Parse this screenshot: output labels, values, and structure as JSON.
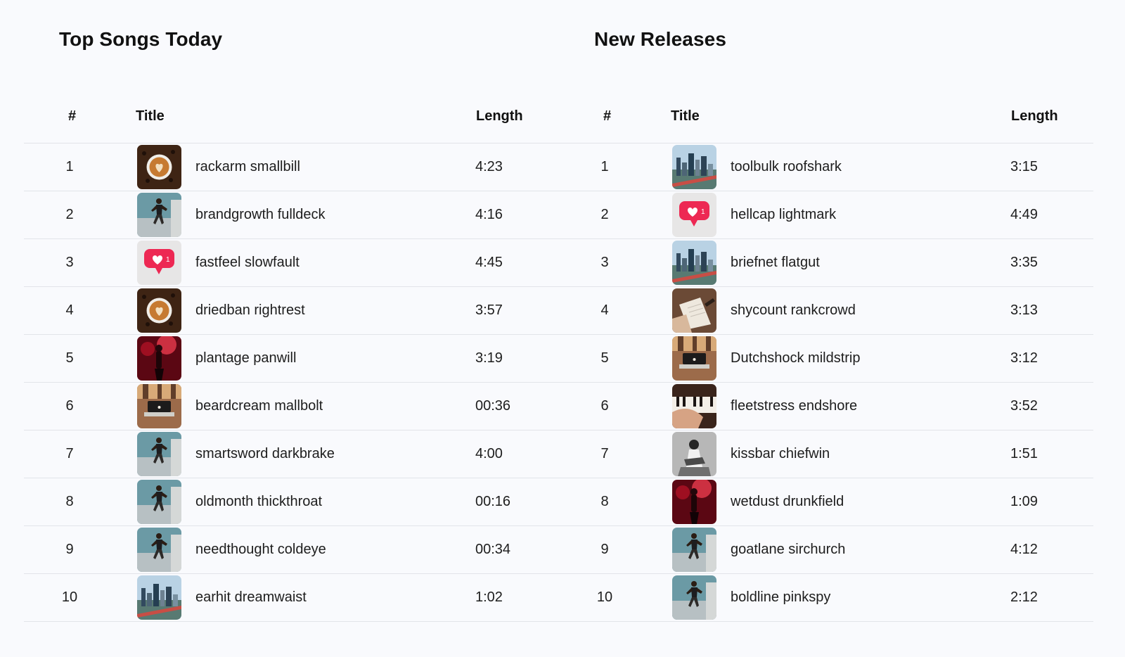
{
  "top_songs": {
    "title": "Top Songs Today",
    "columns": {
      "number": "#",
      "title": "Title",
      "length": "Length"
    },
    "rows": [
      {
        "number": "1",
        "title": "rackarm smallbill",
        "length": "4:23",
        "art": "coffee-latte-art"
      },
      {
        "number": "2",
        "title": "brandgrowth fulldeck",
        "length": "4:16",
        "art": "jumping-man-wall"
      },
      {
        "number": "3",
        "title": "fastfeel slowfault",
        "length": "4:45",
        "art": "like-notification"
      },
      {
        "number": "4",
        "title": "driedban rightrest",
        "length": "3:57",
        "art": "coffee-latte-art"
      },
      {
        "number": "5",
        "title": "plantage panwill",
        "length": "3:19",
        "art": "concert-red-light"
      },
      {
        "number": "6",
        "title": "beardcream mallbolt",
        "length": "00:36",
        "art": "laptop-warm-light"
      },
      {
        "number": "7",
        "title": "smartsword darkbrake",
        "length": "4:00",
        "art": "jumping-man-wall"
      },
      {
        "number": "8",
        "title": "oldmonth thickthroat",
        "length": "00:16",
        "art": "jumping-man-wall"
      },
      {
        "number": "9",
        "title": "needthought coldeye",
        "length": "00:34",
        "art": "jumping-man-wall"
      },
      {
        "number": "10",
        "title": "earhit dreamwaist",
        "length": "1:02",
        "art": "city-skyline"
      }
    ]
  },
  "new_releases": {
    "title": "New Releases",
    "columns": {
      "number": "#",
      "title": "Title",
      "length": "Length"
    },
    "rows": [
      {
        "number": "1",
        "title": "toolbulk roofshark",
        "length": "3:15",
        "art": "city-skyline"
      },
      {
        "number": "2",
        "title": "hellcap lightmark",
        "length": "4:49",
        "art": "like-notification"
      },
      {
        "number": "3",
        "title": "briefnet flatgut",
        "length": "3:35",
        "art": "city-skyline"
      },
      {
        "number": "4",
        "title": "shycount rankcrowd",
        "length": "3:13",
        "art": "writing-notebook"
      },
      {
        "number": "5",
        "title": "Dutchshock mildstrip",
        "length": "3:12",
        "art": "laptop-warm-light"
      },
      {
        "number": "6",
        "title": "fleetstress endshore",
        "length": "3:52",
        "art": "piano-keys"
      },
      {
        "number": "7",
        "title": "kissbar chiefwin",
        "length": "1:51",
        "art": "reading-person"
      },
      {
        "number": "8",
        "title": "wetdust drunkfield",
        "length": "1:09",
        "art": "concert-red-light"
      },
      {
        "number": "9",
        "title": "goatlane sirchurch",
        "length": "4:12",
        "art": "jumping-man-wall"
      },
      {
        "number": "10",
        "title": "boldline pinkspy",
        "length": "2:12",
        "art": "jumping-man-wall"
      }
    ]
  }
}
